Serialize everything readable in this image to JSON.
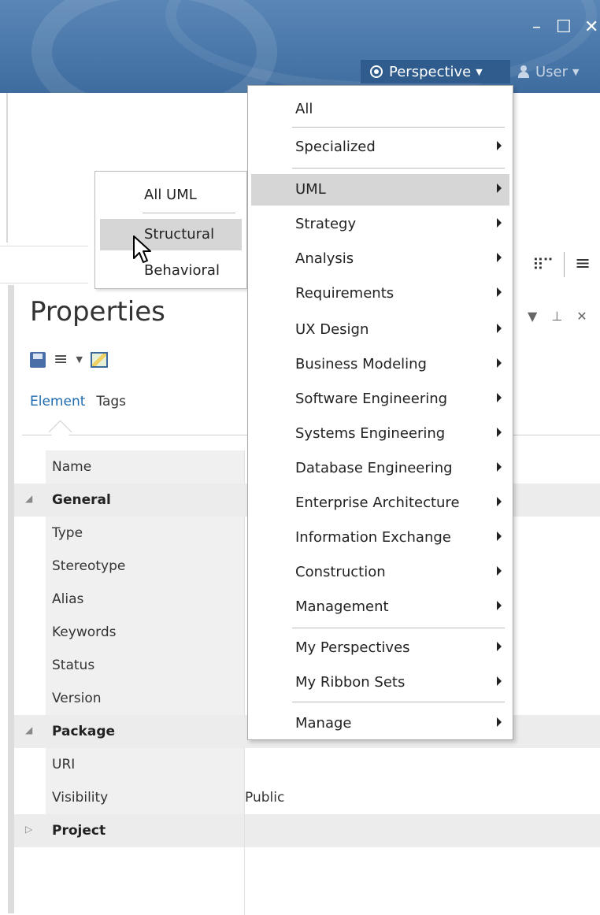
{
  "window": {
    "minimize_glyph": "–",
    "maximize_glyph": "☐",
    "close_glyph": "✕"
  },
  "header": {
    "perspective_label": "Perspective",
    "user_label": "User"
  },
  "menu": {
    "items": [
      {
        "label": "All",
        "submenu": false
      },
      {
        "label": "Specialized",
        "submenu": true
      },
      {
        "label": "UML",
        "submenu": true,
        "highlighted": true
      },
      {
        "label": "Strategy",
        "submenu": true
      },
      {
        "label": "Analysis",
        "submenu": true
      },
      {
        "label": "Requirements",
        "submenu": true
      },
      {
        "label": "UX Design",
        "submenu": true
      },
      {
        "label": "Business Modeling",
        "submenu": true
      },
      {
        "label": "Software Engineering",
        "submenu": true
      },
      {
        "label": "Systems Engineering",
        "submenu": true
      },
      {
        "label": "Database Engineering",
        "submenu": true
      },
      {
        "label": "Enterprise Architecture",
        "submenu": true
      },
      {
        "label": "Information Exchange",
        "submenu": true
      },
      {
        "label": "Construction",
        "submenu": true
      },
      {
        "label": "Management",
        "submenu": true
      },
      {
        "label": "My Perspectives",
        "submenu": true
      },
      {
        "label": "My Ribbon Sets",
        "submenu": true
      },
      {
        "label": "Manage",
        "submenu": true
      }
    ]
  },
  "submenu": {
    "all_uml": "All UML",
    "structural": "Structural",
    "behavioral": "Behavioral"
  },
  "properties": {
    "title": "Properties",
    "tab_element": "Element",
    "tab_tags": "Tags",
    "rows": [
      {
        "kind": "prop",
        "key": "Name",
        "value": ""
      },
      {
        "kind": "group",
        "key": "General",
        "expanded": true
      },
      {
        "kind": "prop",
        "key": "Type",
        "value": ""
      },
      {
        "kind": "prop",
        "key": "Stereotype",
        "value": ""
      },
      {
        "kind": "prop",
        "key": "Alias",
        "value": ""
      },
      {
        "kind": "prop",
        "key": "Keywords",
        "value": ""
      },
      {
        "kind": "prop",
        "key": "Status",
        "value": ""
      },
      {
        "kind": "prop",
        "key": "Version",
        "value": ""
      },
      {
        "kind": "group",
        "key": "Package",
        "expanded": true
      },
      {
        "kind": "prop",
        "key": "URI",
        "value": ""
      },
      {
        "kind": "prop",
        "key": "Visibility",
        "value": "Public"
      },
      {
        "kind": "group",
        "key": "Project",
        "expanded": false
      }
    ]
  }
}
